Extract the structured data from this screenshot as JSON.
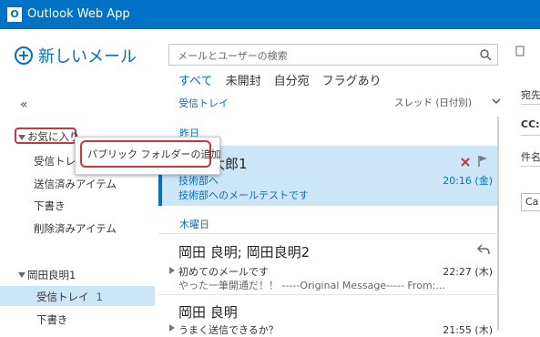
{
  "app": {
    "title": "Outlook Web App",
    "logo_letter": "O"
  },
  "new_mail": {
    "label": "新しいメール"
  },
  "search": {
    "placeholder": "メールとユーザーの検索"
  },
  "filters": [
    {
      "label": "すべて",
      "active": true
    },
    {
      "label": "未開封",
      "active": false
    },
    {
      "label": "自分宛",
      "active": false
    },
    {
      "label": "フラグあり",
      "active": false
    }
  ],
  "list_header": {
    "folder": "受信トレイ",
    "sort": "スレッド (日付別)"
  },
  "nav": {
    "collapse": "«",
    "favorites_label": "お気に入り",
    "favorites": [
      "受信トレイ",
      "送信済みアイテム",
      "下書き",
      "削除済みアイテム"
    ],
    "account_label": "岡田良明1",
    "account_items": [
      {
        "label": "受信トレイ",
        "count": "1"
      },
      {
        "label": "下書き",
        "count": ""
      }
    ]
  },
  "context_menu": {
    "item": "パブリック フォルダーの追加"
  },
  "messages": {
    "group1": "昨日",
    "group2": "木曜日",
    "m1": {
      "sender": "太郎1",
      "subject": "技術部へ",
      "time": "20:16 (金)",
      "preview": "技術部へのメールテストです"
    },
    "m2": {
      "sender": "岡田 良明; 岡田良明2",
      "subject": "初めてのメールです",
      "time": "22:27 (木)",
      "preview": "やった一筆開通だ！！ -----Original Message----- From:..."
    },
    "m3": {
      "sender": "岡田 良明",
      "subject": "うまく送信できるか？",
      "time": "21:55 (木)"
    }
  },
  "reading_pane": {
    "to": "宛先",
    "cc": "CC:",
    "subject": "件名",
    "button": "Ca"
  },
  "colors": {
    "accent": "#0072c6",
    "selection": "#cde6f7",
    "highlight": "#d13438"
  }
}
